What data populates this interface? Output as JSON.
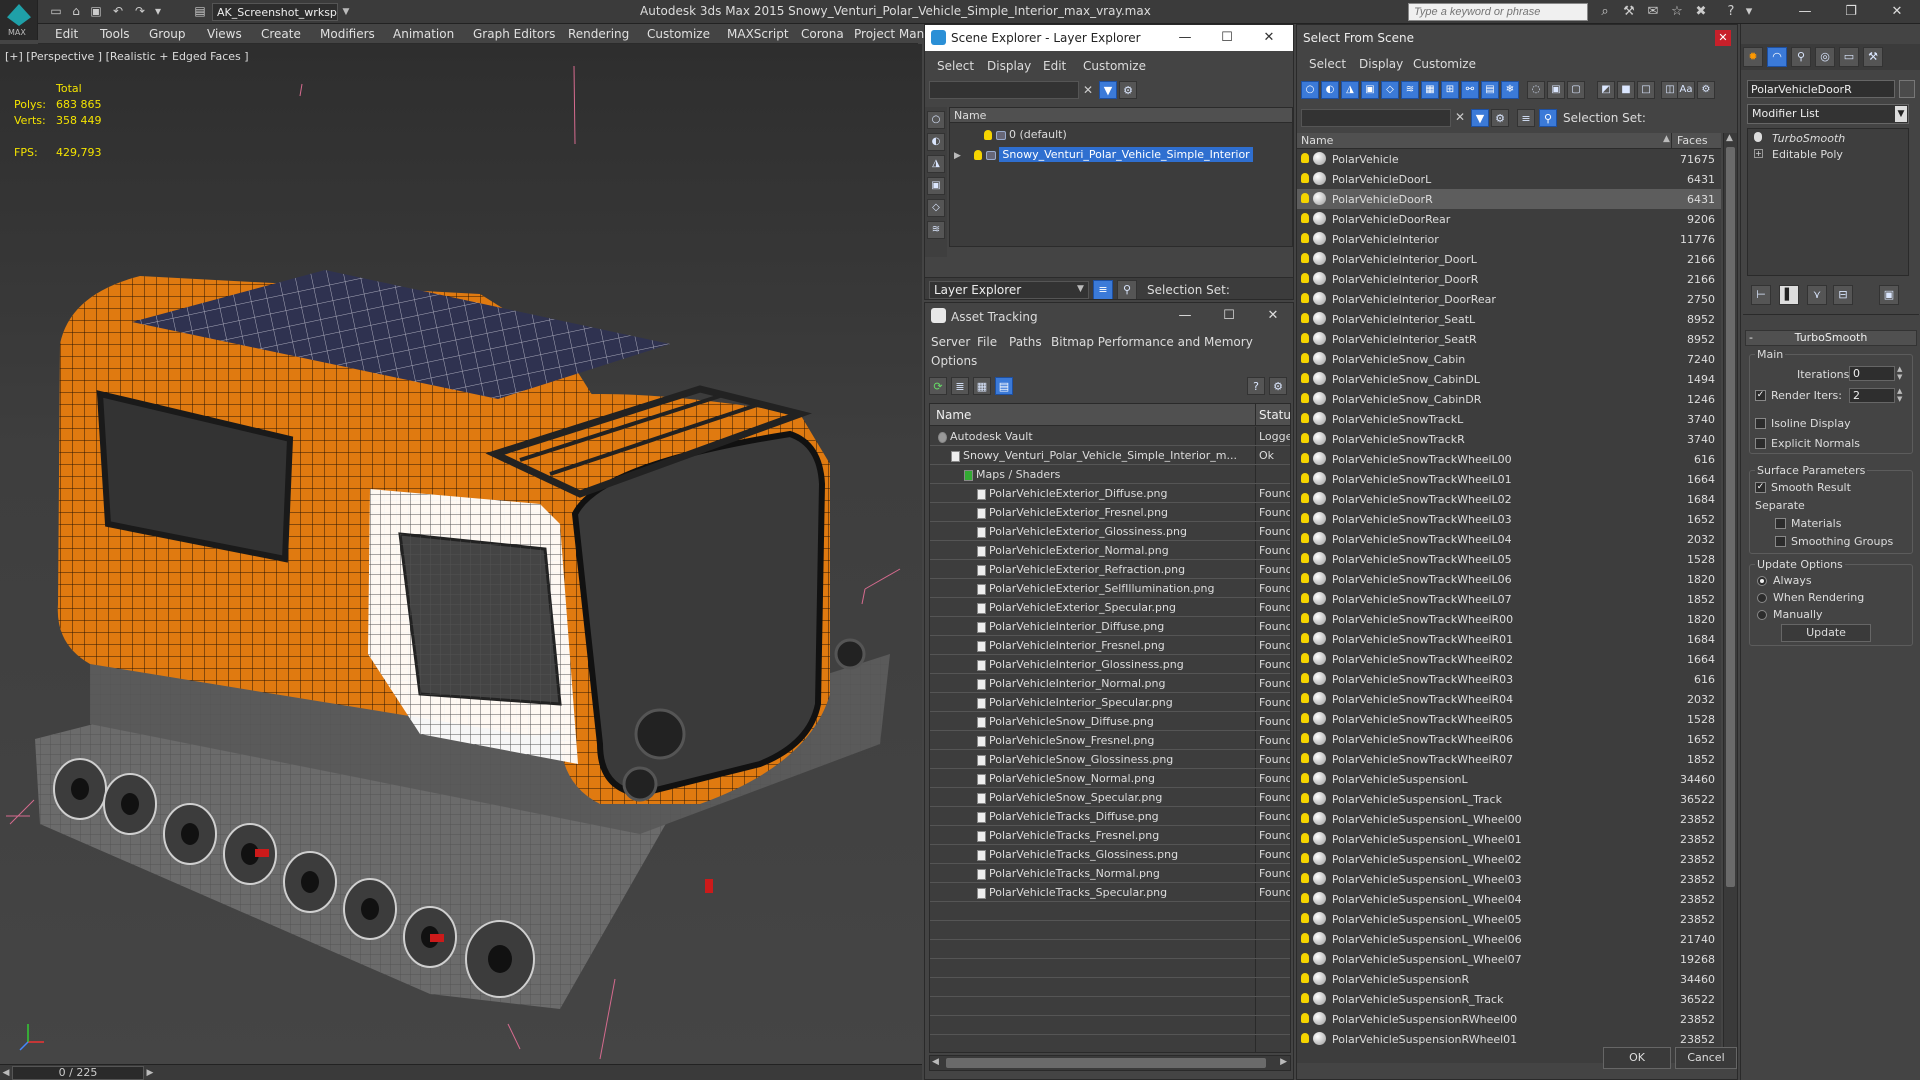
{
  "app": {
    "logo_label": "MAX",
    "workspace": "AK_Screenshot_wrksp",
    "title": "Autodesk 3ds Max 2015    Snowy_Venturi_Polar_Vehicle_Simple_Interior_max_vray.max",
    "search_placeholder": "Type a keyword or phrase"
  },
  "menubar": [
    "Edit",
    "Tools",
    "Group",
    "Views",
    "Create",
    "Modifiers",
    "Animation",
    "Graph Editors",
    "Rendering",
    "Customize",
    "MAXScript",
    "Corona",
    "Project Man"
  ],
  "viewport": {
    "label": "[+] [Perspective ] [Realistic + Edged Faces ]",
    "stats_header": "Total",
    "polys_label": "Polys:",
    "polys_value": "683 865",
    "verts_label": "Verts:",
    "verts_value": "358 449",
    "fps_label": "FPS:",
    "fps_value": "429,793",
    "time_slider": "0 / 225"
  },
  "scene_explorer": {
    "title": "Scene Explorer - Layer Explorer",
    "menus": [
      "Select",
      "Display",
      "Edit",
      "Customize"
    ],
    "column_name": "Name",
    "layers": [
      "0 (default)",
      "Snowy_Venturi_Polar_Vehicle_Simple_Interior"
    ],
    "footer_combo": "Layer Explorer",
    "selection_set_label": "Selection Set:"
  },
  "asset_tracking": {
    "title": "Asset Tracking",
    "menus": [
      "Server",
      "File",
      "Paths",
      "Bitmap Performance and Memory"
    ],
    "menu_row2": "Options",
    "col_name": "Name",
    "col_status": "Status",
    "rows": [
      {
        "name": "Autodesk Vault",
        "status": "Logged",
        "indent": 0
      },
      {
        "name": "Snowy_Venturi_Polar_Vehicle_Simple_Interior_m...",
        "status": "Ok",
        "indent": 1
      },
      {
        "name": "Maps / Shaders",
        "status": "",
        "indent": 2
      },
      {
        "name": "PolarVehicleExterior_Diffuse.png",
        "status": "Found",
        "indent": 3
      },
      {
        "name": "PolarVehicleExterior_Fresnel.png",
        "status": "Found",
        "indent": 3
      },
      {
        "name": "PolarVehicleExterior_Glossiness.png",
        "status": "Found",
        "indent": 3
      },
      {
        "name": "PolarVehicleExterior_Normal.png",
        "status": "Found",
        "indent": 3
      },
      {
        "name": "PolarVehicleExterior_Refraction.png",
        "status": "Found",
        "indent": 3
      },
      {
        "name": "PolarVehicleExterior_SelfIllumination.png",
        "status": "Found",
        "indent": 3
      },
      {
        "name": "PolarVehicleExterior_Specular.png",
        "status": "Found",
        "indent": 3
      },
      {
        "name": "PolarVehicleInterior_Diffuse.png",
        "status": "Found",
        "indent": 3
      },
      {
        "name": "PolarVehicleInterior_Fresnel.png",
        "status": "Found",
        "indent": 3
      },
      {
        "name": "PolarVehicleInterior_Glossiness.png",
        "status": "Found",
        "indent": 3
      },
      {
        "name": "PolarVehicleInterior_Normal.png",
        "status": "Found",
        "indent": 3
      },
      {
        "name": "PolarVehicleInterior_Specular.png",
        "status": "Found",
        "indent": 3
      },
      {
        "name": "PolarVehicleSnow_Diffuse.png",
        "status": "Found",
        "indent": 3
      },
      {
        "name": "PolarVehicleSnow_Fresnel.png",
        "status": "Found",
        "indent": 3
      },
      {
        "name": "PolarVehicleSnow_Glossiness.png",
        "status": "Found",
        "indent": 3
      },
      {
        "name": "PolarVehicleSnow_Normal.png",
        "status": "Found",
        "indent": 3
      },
      {
        "name": "PolarVehicleSnow_Specular.png",
        "status": "Found",
        "indent": 3
      },
      {
        "name": "PolarVehicleTracks_Diffuse.png",
        "status": "Found",
        "indent": 3
      },
      {
        "name": "PolarVehicleTracks_Fresnel.png",
        "status": "Found",
        "indent": 3
      },
      {
        "name": "PolarVehicleTracks_Glossiness.png",
        "status": "Found",
        "indent": 3
      },
      {
        "name": "PolarVehicleTracks_Normal.png",
        "status": "Found",
        "indent": 3
      },
      {
        "name": "PolarVehicleTracks_Specular.png",
        "status": "Found",
        "indent": 3
      }
    ]
  },
  "select_from_scene": {
    "title": "Select From Scene",
    "menus": [
      "Select",
      "Display",
      "Customize"
    ],
    "selection_set_label": "Selection Set:",
    "col_name": "Name",
    "col_faces": "Faces",
    "selected_index": 2,
    "objects": [
      {
        "name": "PolarVehicle",
        "faces": "71675"
      },
      {
        "name": "PolarVehicleDoorL",
        "faces": "6431"
      },
      {
        "name": "PolarVehicleDoorR",
        "faces": "6431"
      },
      {
        "name": "PolarVehicleDoorRear",
        "faces": "9206"
      },
      {
        "name": "PolarVehicleInterior",
        "faces": "11776"
      },
      {
        "name": "PolarVehicleInterior_DoorL",
        "faces": "2166"
      },
      {
        "name": "PolarVehicleInterior_DoorR",
        "faces": "2166"
      },
      {
        "name": "PolarVehicleInterior_DoorRear",
        "faces": "2750"
      },
      {
        "name": "PolarVehicleInterior_SeatL",
        "faces": "8952"
      },
      {
        "name": "PolarVehicleInterior_SeatR",
        "faces": "8952"
      },
      {
        "name": "PolarVehicleSnow_Cabin",
        "faces": "7240"
      },
      {
        "name": "PolarVehicleSnow_CabinDL",
        "faces": "1494"
      },
      {
        "name": "PolarVehicleSnow_CabinDR",
        "faces": "1246"
      },
      {
        "name": "PolarVehicleSnowTrackL",
        "faces": "3740"
      },
      {
        "name": "PolarVehicleSnowTrackR",
        "faces": "3740"
      },
      {
        "name": "PolarVehicleSnowTrackWheelL00",
        "faces": "616"
      },
      {
        "name": "PolarVehicleSnowTrackWheelL01",
        "faces": "1664"
      },
      {
        "name": "PolarVehicleSnowTrackWheelL02",
        "faces": "1684"
      },
      {
        "name": "PolarVehicleSnowTrackWheelL03",
        "faces": "1652"
      },
      {
        "name": "PolarVehicleSnowTrackWheelL04",
        "faces": "2032"
      },
      {
        "name": "PolarVehicleSnowTrackWheelL05",
        "faces": "1528"
      },
      {
        "name": "PolarVehicleSnowTrackWheelL06",
        "faces": "1820"
      },
      {
        "name": "PolarVehicleSnowTrackWheelL07",
        "faces": "1852"
      },
      {
        "name": "PolarVehicleSnowTrackWheelR00",
        "faces": "1820"
      },
      {
        "name": "PolarVehicleSnowTrackWheelR01",
        "faces": "1684"
      },
      {
        "name": "PolarVehicleSnowTrackWheelR02",
        "faces": "1664"
      },
      {
        "name": "PolarVehicleSnowTrackWheelR03",
        "faces": "616"
      },
      {
        "name": "PolarVehicleSnowTrackWheelR04",
        "faces": "2032"
      },
      {
        "name": "PolarVehicleSnowTrackWheelR05",
        "faces": "1528"
      },
      {
        "name": "PolarVehicleSnowTrackWheelR06",
        "faces": "1652"
      },
      {
        "name": "PolarVehicleSnowTrackWheelR07",
        "faces": "1852"
      },
      {
        "name": "PolarVehicleSuspensionL",
        "faces": "34460"
      },
      {
        "name": "PolarVehicleSuspensionL_Track",
        "faces": "36522"
      },
      {
        "name": "PolarVehicleSuspensionL_Wheel00",
        "faces": "23852"
      },
      {
        "name": "PolarVehicleSuspensionL_Wheel01",
        "faces": "23852"
      },
      {
        "name": "PolarVehicleSuspensionL_Wheel02",
        "faces": "23852"
      },
      {
        "name": "PolarVehicleSuspensionL_Wheel03",
        "faces": "23852"
      },
      {
        "name": "PolarVehicleSuspensionL_Wheel04",
        "faces": "23852"
      },
      {
        "name": "PolarVehicleSuspensionL_Wheel05",
        "faces": "23852"
      },
      {
        "name": "PolarVehicleSuspensionL_Wheel06",
        "faces": "21740"
      },
      {
        "name": "PolarVehicleSuspensionL_Wheel07",
        "faces": "19268"
      },
      {
        "name": "PolarVehicleSuspensionR",
        "faces": "34460"
      },
      {
        "name": "PolarVehicleSuspensionR_Track",
        "faces": "36522"
      },
      {
        "name": "PolarVehicleSuspensionRWheel00",
        "faces": "23852"
      },
      {
        "name": "PolarVehicleSuspensionRWheel01",
        "faces": "23852"
      }
    ],
    "ok_label": "OK",
    "cancel_label": "Cancel"
  },
  "command_panel": {
    "object_name": "PolarVehicleDoorR",
    "modifier_list": "Modifier List",
    "stack": [
      "TurboSmooth",
      "Editable Poly"
    ],
    "rollout_title": "TurboSmooth",
    "main_label": "Main",
    "iterations_label": "Iterations:",
    "iterations_value": "0",
    "render_iters_label": "Render Iters:",
    "render_iters_value": "2",
    "render_iters_checked": true,
    "isoline_label": "Isoline Display",
    "explicit_normals_label": "Explicit Normals",
    "surface_params_label": "Surface Parameters",
    "smooth_result_label": "Smooth Result",
    "smooth_result_checked": true,
    "separate_label": "Separate",
    "materials_label": "Materials",
    "smoothing_groups_label": "Smoothing Groups",
    "update_options_label": "Update Options",
    "always_label": "Always",
    "when_rendering_label": "When Rendering",
    "manually_label": "Manually",
    "update_button": "Update"
  },
  "colors": {
    "vehicle_orange": "#e07a10",
    "selection_blue": "#3b7ad8",
    "stats_yellow": "#f4e300"
  }
}
